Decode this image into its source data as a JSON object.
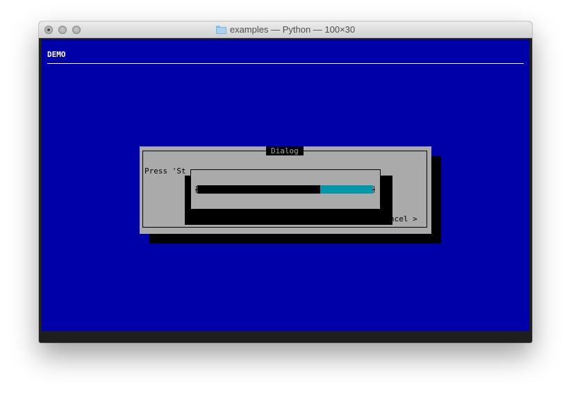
{
  "window": {
    "title": "examples — Python — 100×30",
    "folder_icon": "folder-icon",
    "buttons": [
      "close",
      "minimize",
      "zoom"
    ]
  },
  "terminal": {
    "background": "#0000a8",
    "backtitle": "DEMO"
  },
  "dialog": {
    "title": "Dialog",
    "prompt": "Press 'St",
    "cancel_label": "ncel >",
    "background": "#aaaaaa"
  },
  "gauge": {
    "progress": 0.3,
    "fill_color": "#0097a8",
    "track_color": "#000000"
  }
}
